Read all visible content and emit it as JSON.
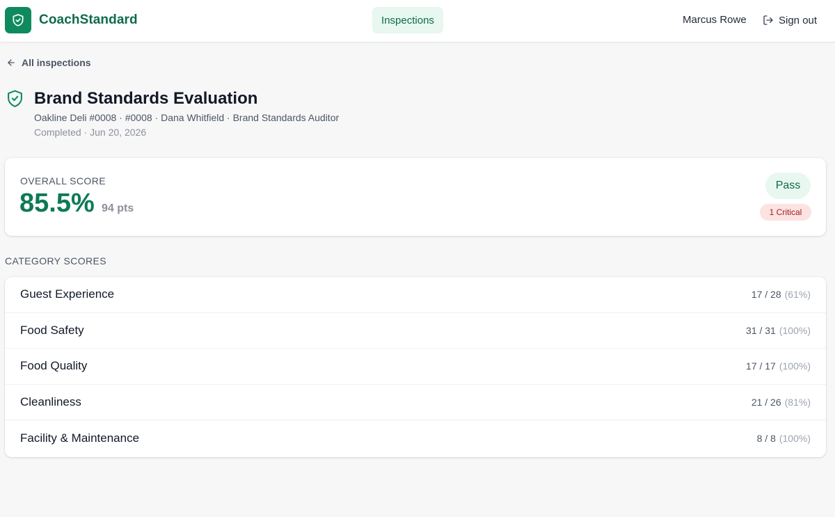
{
  "header": {
    "brand": "CoachStandard",
    "nav_tab": "Inspections",
    "user_name": "Marcus Rowe",
    "signout_label": "Sign out",
    "brand_color": "#0f8a5f"
  },
  "back_link": {
    "label": "All inspections"
  },
  "inspection": {
    "title": "Brand Standards Evaluation",
    "subtitle": "Oakline Deli #0008 · #0008 · Dana Whitfield · Brand Standards Auditor",
    "status_line": "Completed · Jun 20, 2026"
  },
  "overall": {
    "label": "OVERALL SCORE",
    "score": "85.5%",
    "points": "94 pts",
    "result_badge": "Pass",
    "critical_badge": "1 Critical"
  },
  "categories": {
    "label": "CATEGORY SCORES",
    "rows": [
      {
        "name": "Guest Experience",
        "score": "17 / 28",
        "pct": "(61%)"
      },
      {
        "name": "Food Safety",
        "score": "31 / 31",
        "pct": "(100%)"
      },
      {
        "name": "Food Quality",
        "score": "17 / 17",
        "pct": "(100%)"
      },
      {
        "name": "Cleanliness",
        "score": "21 / 26",
        "pct": "(81%)"
      },
      {
        "name": "Facility & Maintenance",
        "score": "8 / 8",
        "pct": "(100%)"
      }
    ]
  }
}
